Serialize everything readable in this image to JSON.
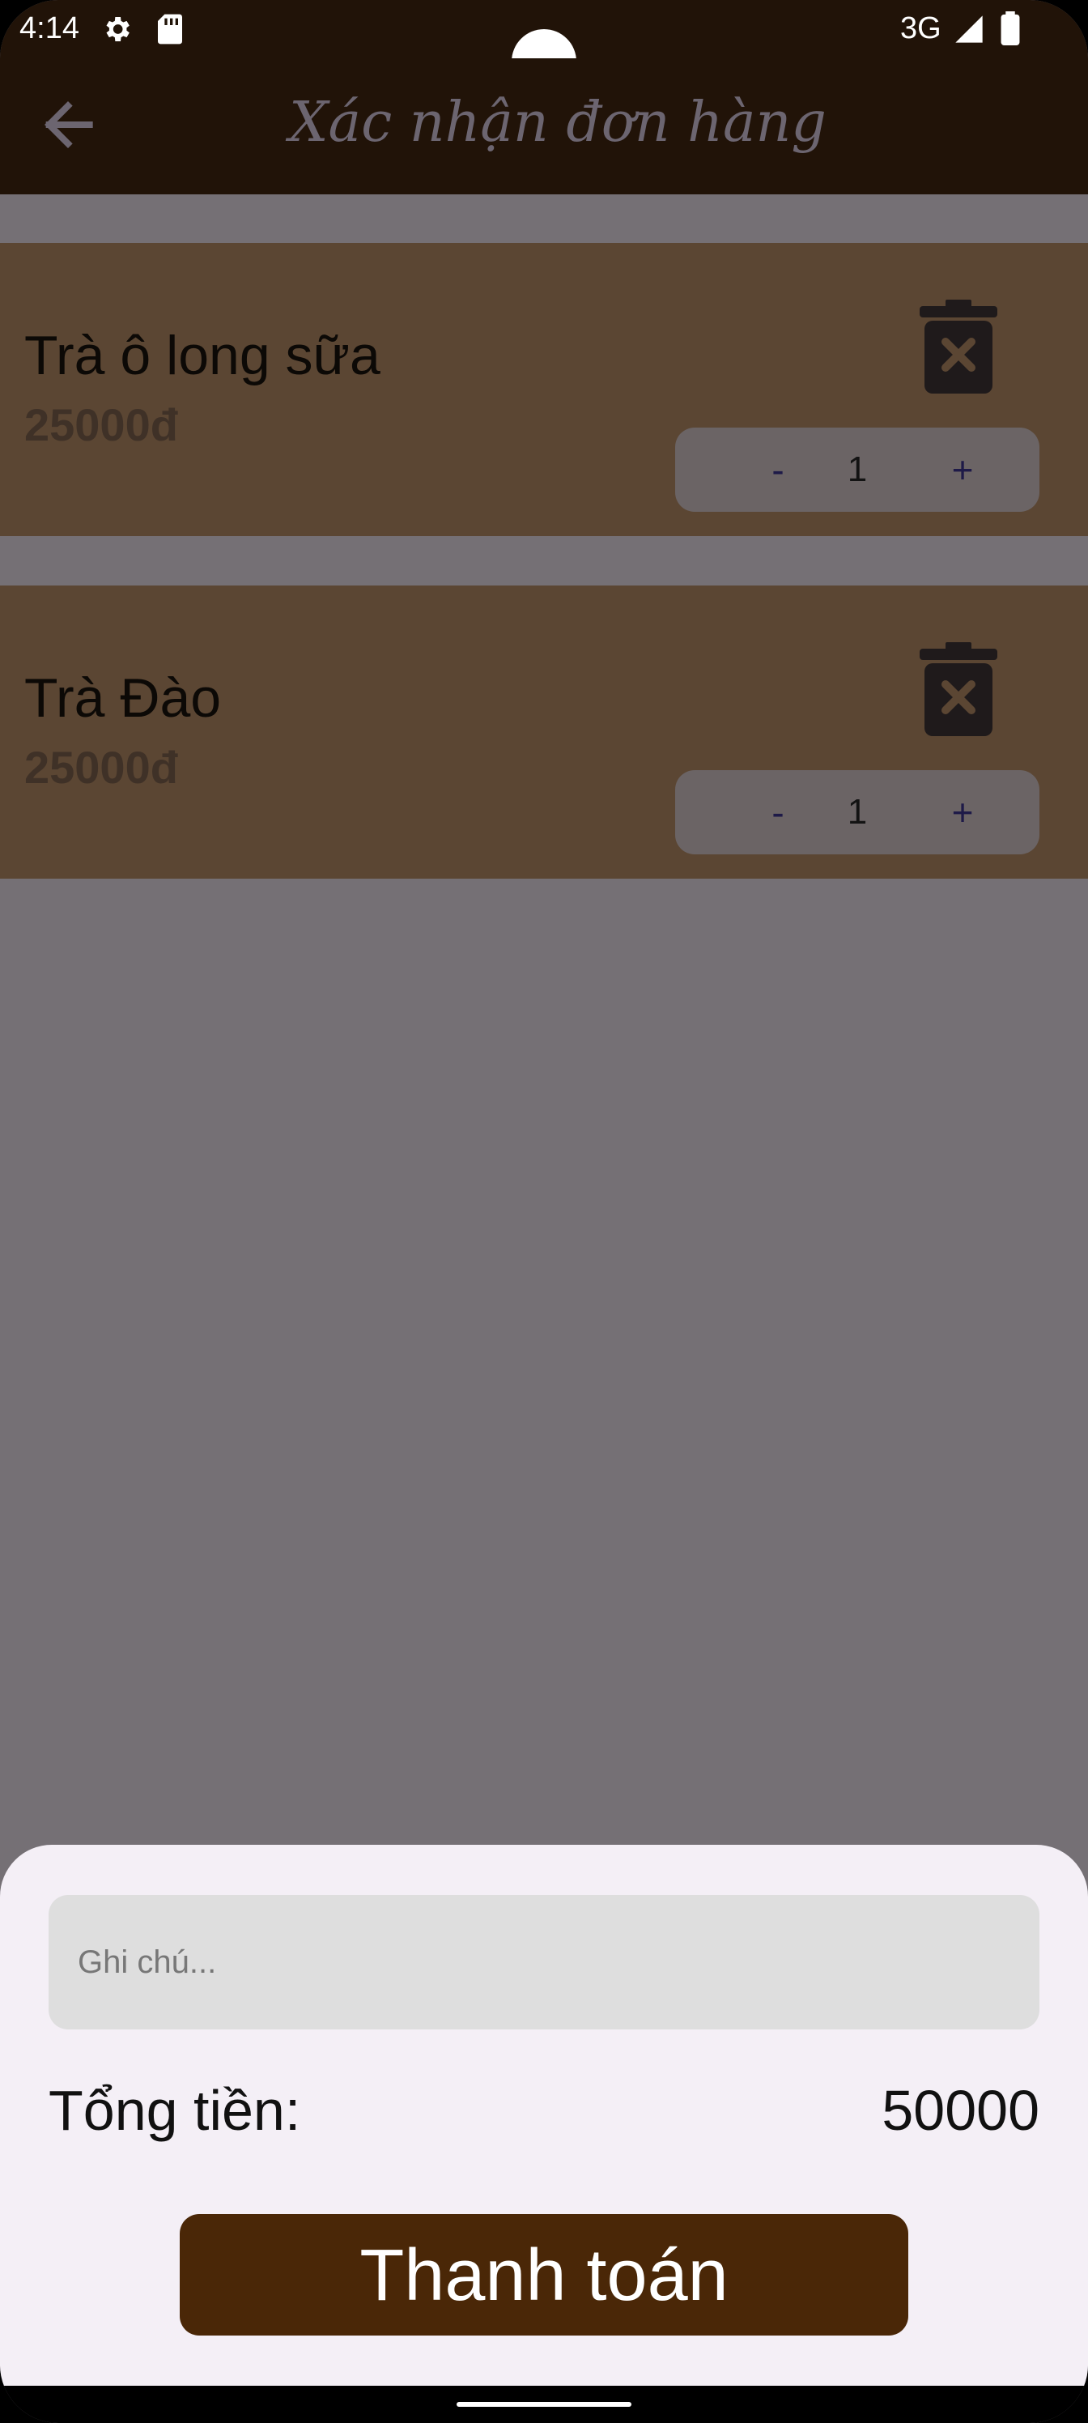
{
  "status_bar": {
    "time": "4:14",
    "network": "3G",
    "icons": [
      "gear-icon",
      "sd-card-icon",
      "signal-icon",
      "battery-icon"
    ]
  },
  "app_bar": {
    "title": "Xác nhận đơn hàng",
    "back_icon": "arrow-left-icon"
  },
  "cart": {
    "items": [
      {
        "name": "Trà ô long sữa",
        "price": "25000đ",
        "quantity": "1"
      },
      {
        "name": "Trà Đào",
        "price": "25000đ",
        "quantity": "1"
      }
    ],
    "minus_label": "-",
    "plus_label": "+"
  },
  "sheet": {
    "note_placeholder": "Ghi chú...",
    "total_label": "Tổng tiền:",
    "total_value": "50000",
    "pay_label": "Thanh toán"
  },
  "colors": {
    "app_bar": "#211308",
    "item_bg": "#5b4633",
    "scrim": "#757075",
    "pay_button": "#4a2707",
    "sheet": "#f4eff6"
  }
}
